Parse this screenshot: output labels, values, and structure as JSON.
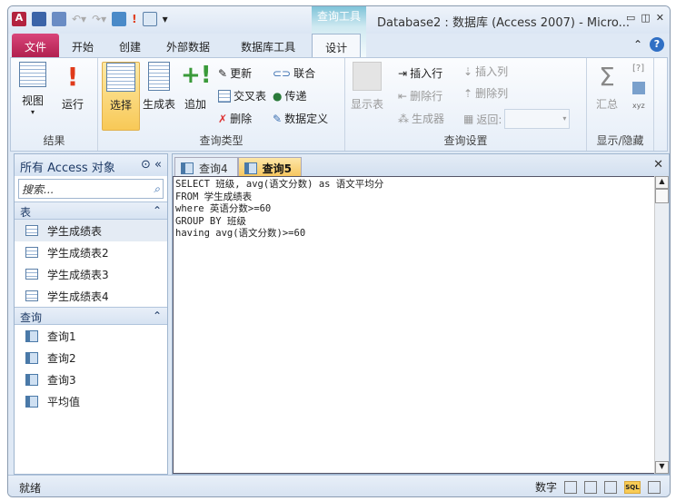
{
  "window": {
    "title": "Database2 : 数据库 (Access 2007)  -  Micro...",
    "context_tab": "查询工具"
  },
  "ribbon_tabs": [
    "文件",
    "开始",
    "创建",
    "外部数据",
    "数据库工具",
    "设计"
  ],
  "ribbon": {
    "results": {
      "label": "结果",
      "view": "视图",
      "run": "运行"
    },
    "query_type": {
      "label": "查询类型",
      "select": "选择",
      "make_table": "生成表",
      "append": "追加",
      "update": "更新",
      "crosstab": "交叉表",
      "delete": "删除",
      "union": "联合",
      "pass_through": "传递",
      "data_definition": "数据定义"
    },
    "query_setup": {
      "label": "查询设置",
      "show_table": "显示表",
      "insert_rows": "插入行",
      "delete_rows": "删除行",
      "builder": "生成器",
      "insert_columns": "插入列",
      "delete_columns": "删除列",
      "return": "返回:",
      "return_value": ""
    },
    "show_hide": {
      "label": "显示/隐藏",
      "totals": "汇总"
    }
  },
  "nav": {
    "title": "所有 Access 对象",
    "search_placeholder": "搜索...",
    "tables_header": "表",
    "tables": [
      "学生成绩表",
      "学生成绩表2",
      "学生成绩表3",
      "学生成绩表4"
    ],
    "queries_header": "查询",
    "queries": [
      "查询1",
      "查询2",
      "查询3",
      "平均值"
    ]
  },
  "doc_tabs": [
    "查询4",
    "查询5"
  ],
  "active_doc_tab": "查询5",
  "sql": "SELECT 班级, avg(语文分数) as 语文平均分\nFROM 学生成绩表\nwhere 英语分数>=60\nGROUP BY 班级\nhaving avg(语文分数)>=60",
  "status": {
    "left": "就绪",
    "mode": "数字",
    "sql_view": "SQL"
  },
  "colors": {
    "file_tab": "#c0245a",
    "selected": "#f8c957",
    "context": "#7ec3d8"
  }
}
